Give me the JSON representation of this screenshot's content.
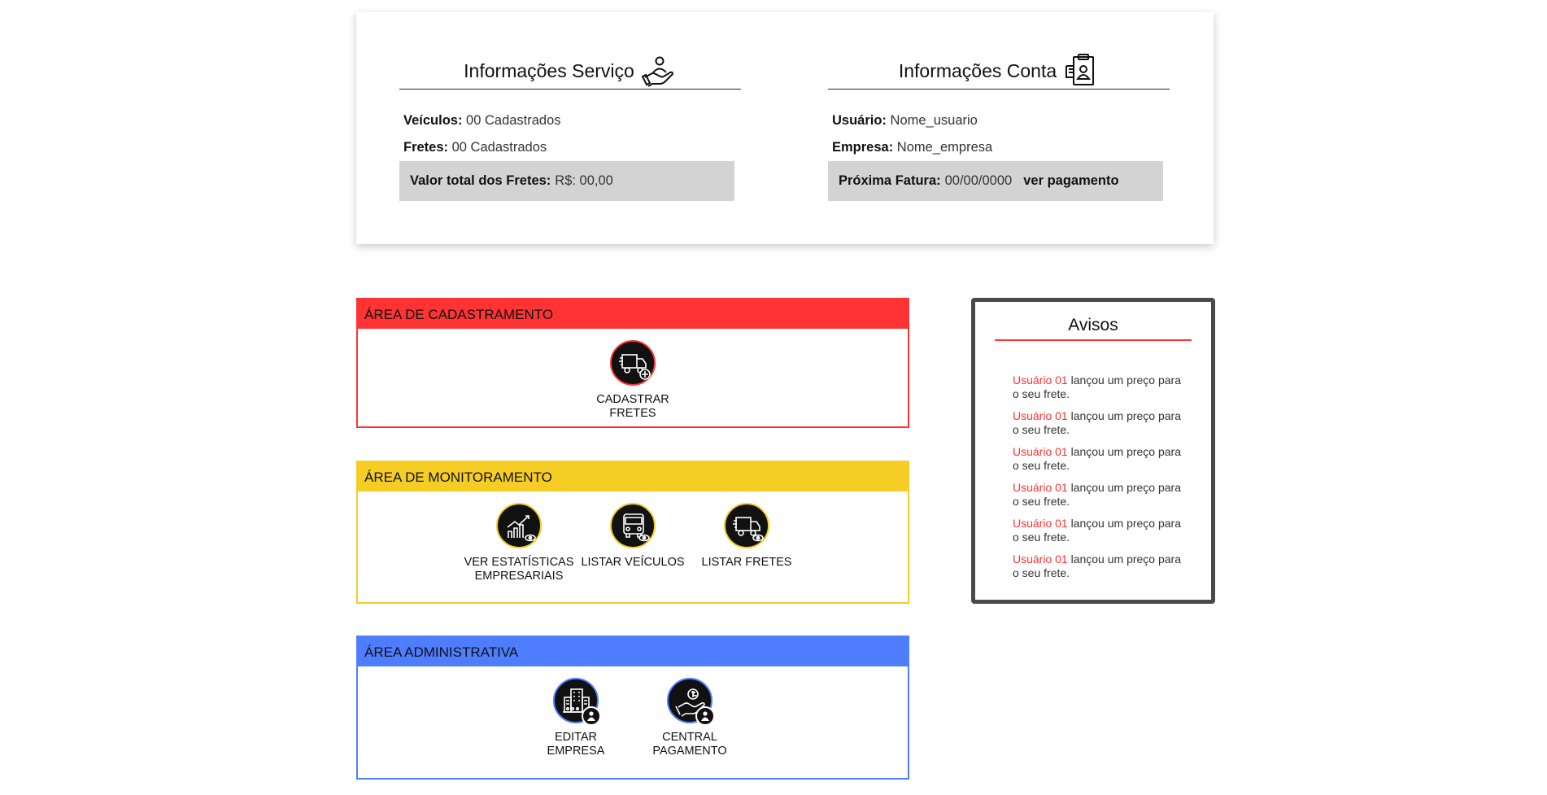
{
  "service": {
    "heading": "Informações Serviço",
    "icon": "hand-person-icon",
    "veiculos_label": "Veículos:",
    "veiculos_value": "00 Cadastrados",
    "fretes_label": "Fretes:",
    "fretes_value": "00 Cadastrados",
    "total_label": "Valor total dos Fretes:",
    "total_value": "R$: 00,00"
  },
  "account": {
    "heading": "Informações Conta",
    "icon": "clipboard-id-icon",
    "usuario_label": "Usuário:",
    "usuario_value": "Nome_usuario",
    "empresa_label": "Empresa:",
    "empresa_value": "Nome_empresa",
    "fatura_label": "Próxima Fatura:",
    "fatura_value": "00/00/0000",
    "pagamento_link": "ver pagamento"
  },
  "areas": {
    "cadastramento": {
      "title": "ÁREA DE CADASTRAMENTO",
      "color": "#ff3333",
      "tiles": [
        {
          "label": "CADASTRAR FRETES",
          "icon": "truck-add-icon"
        }
      ]
    },
    "monitoramento": {
      "title": "ÁREA DE MONITORAMENTO",
      "color": "#f5cd25",
      "tiles": [
        {
          "label_line1": "VER ESTATÍSTICAS",
          "label_line2": "EMPRESARIAIS",
          "icon": "chart-view-icon"
        },
        {
          "label": "LISTAR VEÍCULOS",
          "icon": "truck-front-view-icon"
        },
        {
          "label": "LISTAR FRETES",
          "icon": "truck-view-icon"
        }
      ]
    },
    "administrativa": {
      "title": "ÁREA ADMINISTRATIVA",
      "color": "#4f7dff",
      "tiles": [
        {
          "label_line1": "EDITAR",
          "label_line2": "EMPRESA",
          "icon": "building-user-icon"
        },
        {
          "label_line1": "CENTRAL",
          "label_line2": "PAGAMENTO",
          "icon": "payment-user-icon"
        }
      ]
    }
  },
  "avisos": {
    "title": "Avisos",
    "items": [
      {
        "user": "Usuário 01",
        "text": " lançou um preço para o seu frete."
      },
      {
        "user": "Usuário 01",
        "text": " lançou um preço para o seu frete."
      },
      {
        "user": "Usuário 01",
        "text": " lançou um preço para o seu frete."
      },
      {
        "user": "Usuário 01",
        "text": " lançou um preço para o seu frete."
      },
      {
        "user": "Usuário 01",
        "text": " lançou um preço para o seu frete."
      },
      {
        "user": "Usuário 01",
        "text": " lançou um preço para o seu frete."
      }
    ]
  }
}
